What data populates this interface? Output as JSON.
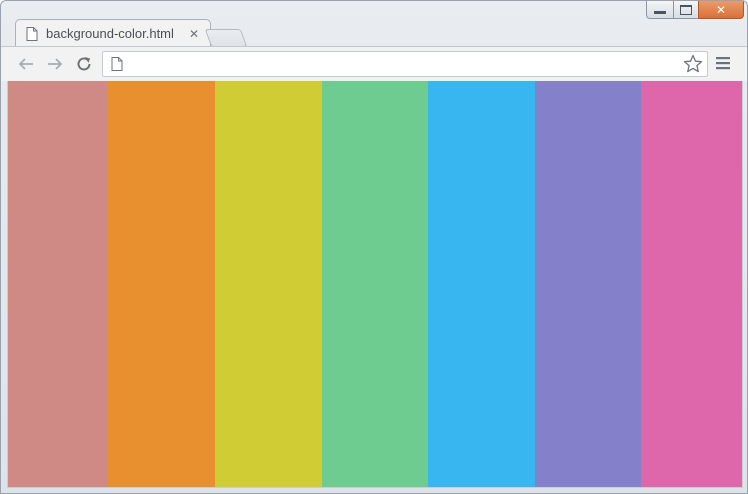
{
  "window": {
    "controls": {
      "minimize": "minimize-icon",
      "maximize": "maximize-icon",
      "close": "✕"
    }
  },
  "tab": {
    "title": "background-color.html",
    "close": "✕",
    "icon": "page-icon"
  },
  "toolbar": {
    "back_icon": "back-arrow-icon",
    "forward_icon": "forward-arrow-icon",
    "reload_icon": "reload-icon",
    "address_value": "",
    "bookmark_icon": "star-icon",
    "menu_icon": "hamburger-menu-icon"
  },
  "content": {
    "stripes": [
      {
        "name": "stripe-1",
        "color": "#d08a86"
      },
      {
        "name": "stripe-2",
        "color": "#e89030"
      },
      {
        "name": "stripe-3",
        "color": "#d0cc34"
      },
      {
        "name": "stripe-4",
        "color": "#6ecc90"
      },
      {
        "name": "stripe-5",
        "color": "#38b6f0"
      },
      {
        "name": "stripe-6",
        "color": "#8480ca"
      },
      {
        "name": "stripe-7",
        "color": "#de66aa"
      }
    ]
  }
}
